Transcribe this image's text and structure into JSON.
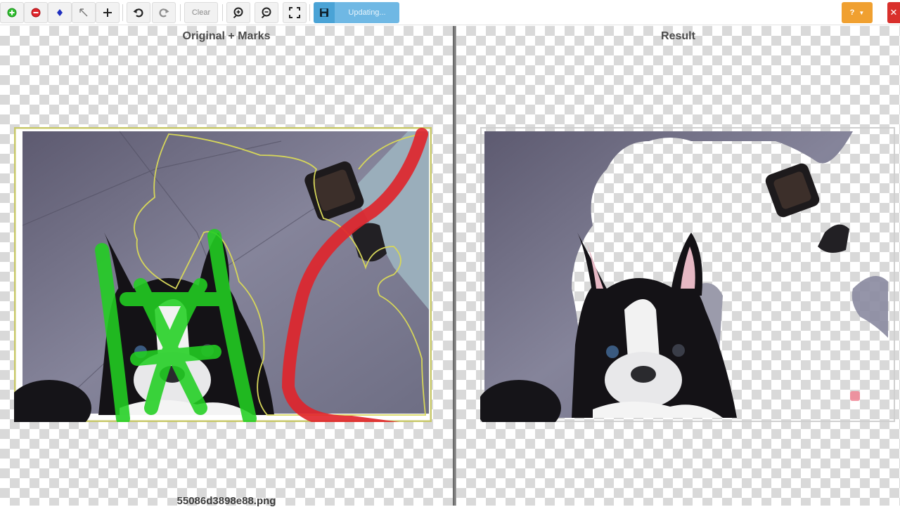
{
  "toolbar": {
    "clear_label": "Clear",
    "updating_label": "Updating...",
    "help_label": "?",
    "icons": [
      "add-foreground-icon",
      "mark-background-icon",
      "hair-detail-icon",
      "eraser-icon",
      "pan-icon",
      "undo-icon",
      "redo-icon",
      "zoom-in-icon",
      "zoom-out-icon",
      "fit-screen-icon",
      "save-icon",
      "dropdown-caret-icon",
      "exit-icon"
    ],
    "colors": {
      "save": "#4aa3d6",
      "updating": "#6fb8e4",
      "help": "#f0a030",
      "exit": "#d9302c"
    }
  },
  "left_pane": {
    "title": "Original + Marks",
    "filename": "55086d3898e88.png"
  },
  "right_pane": {
    "title": "Result"
  },
  "marks": {
    "foreground_color": "#22d022",
    "background_color": "#e0242a",
    "outline_color": "#d6d65a"
  }
}
